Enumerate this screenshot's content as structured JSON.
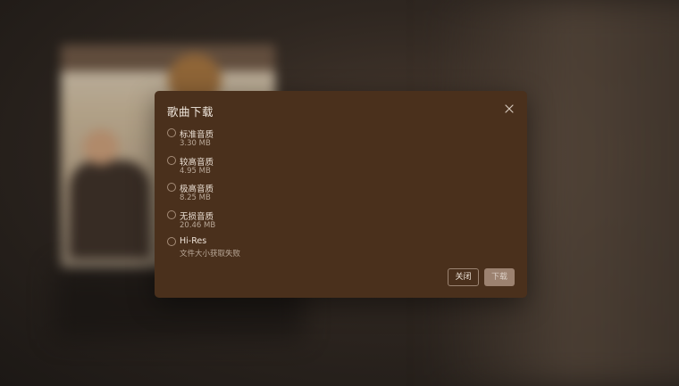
{
  "dialog": {
    "title": "歌曲下载",
    "close_icon": "close-icon",
    "options": [
      {
        "label": "标准音质",
        "size": "3.30 MB"
      },
      {
        "label": "较高音质",
        "size": "4.95 MB"
      },
      {
        "label": "极高音质",
        "size": "8.25 MB"
      },
      {
        "label": "无损音质",
        "size": "20.46 MB"
      },
      {
        "label": "Hi-Res",
        "size": "文件大小获取失败"
      }
    ],
    "buttons": {
      "close_label": "关闭",
      "download_label": "下载"
    }
  },
  "colors": {
    "dialog_bg": "#4a301c",
    "download_button_bg": "#9c8270"
  }
}
